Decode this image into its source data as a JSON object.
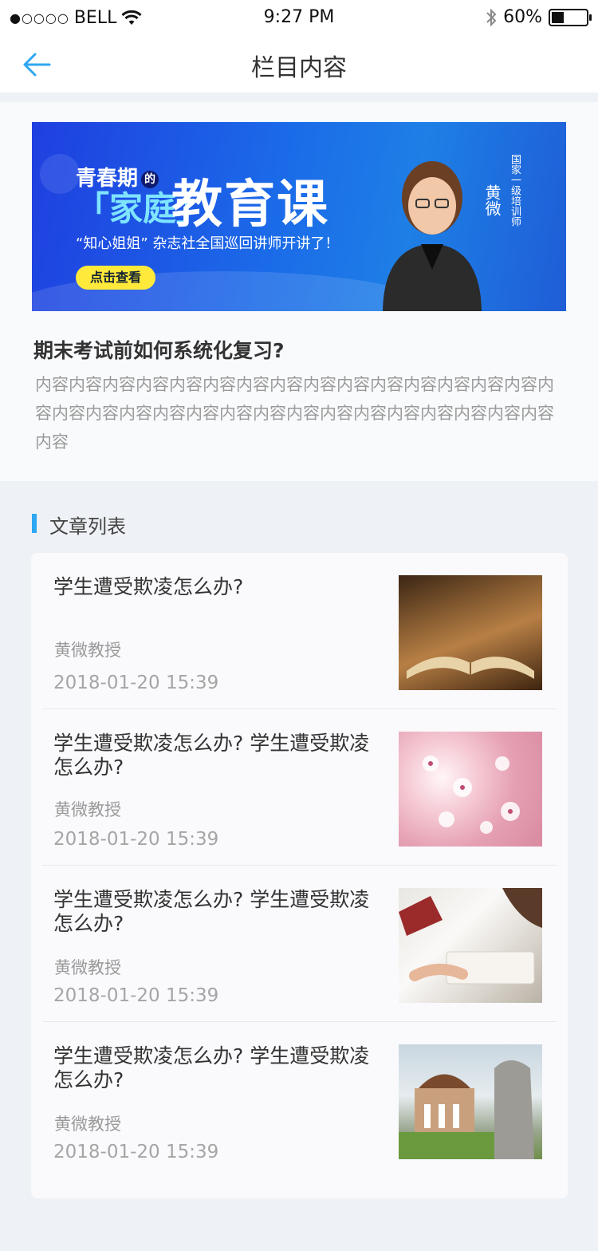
{
  "status_bar": {
    "signal": "●○○○○",
    "carrier": "BELL",
    "time": "9:27 PM",
    "battery_percent": "60%",
    "battery_level": 0.35
  },
  "nav": {
    "title": "栏目内容",
    "back_icon": "arrow-left-icon"
  },
  "banner": {
    "line1": "青春期",
    "badge": "的",
    "line2_a": "「家庭」",
    "line2_b": "教育课",
    "line3": "“知心姐姐” 杂志社全国巡回讲师开讲了！",
    "button": "点击查看",
    "name": "黄微",
    "title": "国家一级培训师"
  },
  "top_article": {
    "headline": "期末考试前如何系统化复习?",
    "body": "内容内容内容内容内容内容内容内容内容内容内容内容内容内容内容内容内容内容内容内容内容内容内容内容内容内容内容内容内容内容内容内容"
  },
  "section": {
    "title": "文章列表"
  },
  "articles": [
    {
      "title": "学生遭受欺凌怎么办?",
      "author": "黄微教授",
      "date": "2018-01-20   15:39",
      "thumb": "book"
    },
    {
      "title": "学生遭受欺凌怎么办? 学生遭受欺凌怎么办?",
      "author": "黄微教授",
      "date": "2018-01-20   15:39",
      "thumb": "blossom"
    },
    {
      "title": "学生遭受欺凌怎么办? 学生遭受欺凌怎么办?",
      "author": "黄微教授",
      "date": "2018-01-20   15:39",
      "thumb": "study"
    },
    {
      "title": "学生遭受欺凌怎么办? 学生遭受欺凌怎么办?",
      "author": "黄微教授",
      "date": "2018-01-20   15:39",
      "thumb": "campus"
    }
  ],
  "colors": {
    "accent": "#2ea7f2",
    "banner_blue": "#1f5dd6",
    "button_yellow": "#ffe93a"
  }
}
